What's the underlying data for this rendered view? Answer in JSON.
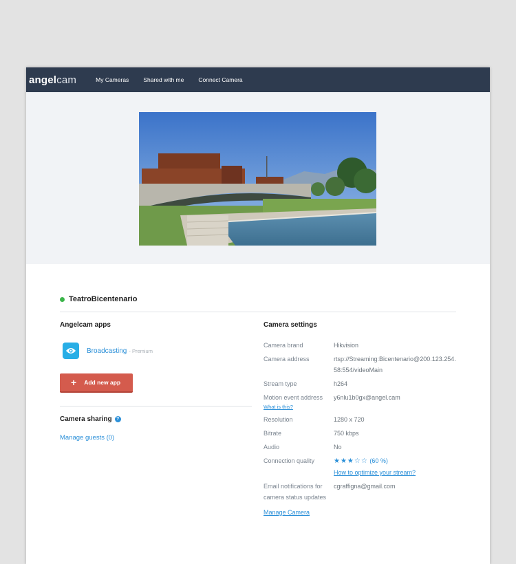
{
  "nav": {
    "logo_bold": "angel",
    "logo_light": "cam",
    "links": [
      "My Cameras",
      "Shared with me",
      "Connect Camera"
    ]
  },
  "camera": {
    "name": "TeatroBicentenario",
    "status_color": "#3bb54a"
  },
  "apps": {
    "title": "Angelcam apps",
    "items": [
      {
        "name": "Broadcasting",
        "tag": "- Premium",
        "icon": "eye-icon"
      }
    ],
    "add_label": "Add new app"
  },
  "sharing": {
    "title": "Camera sharing",
    "help": "?",
    "manage_guests": "Manage guests (0)"
  },
  "settings": {
    "title": "Camera settings",
    "brand_label": "Camera brand",
    "brand": "Hikvision",
    "address_label": "Camera address",
    "address": "rtsp://Streaming:Bicentenario@200.123.254.58:554/videoMain",
    "stream_label": "Stream type",
    "stream": "h264",
    "motion_label": "Motion event address",
    "motion": "y6nlu1b0gx@angel.cam",
    "motion_help": "What is this?",
    "resolution_label": "Resolution",
    "resolution": "1280 x 720",
    "bitrate_label": "Bitrate",
    "bitrate": "750 kbps",
    "audio_label": "Audio",
    "audio": "No",
    "quality_label": "Connection quality",
    "quality_stars": "★★★☆☆",
    "quality_pct": "(60 %)",
    "quality_value": 0.6,
    "optimize_link": "How to optimize your stream?",
    "email_label": "Email notifications for camera status updates",
    "email": "cgraffigna@gmail.com",
    "manage_camera": "Manage Camera"
  },
  "colors": {
    "navbar": "#2e3b4f",
    "accent": "#2a8fd8",
    "button": "#d45b4d"
  }
}
